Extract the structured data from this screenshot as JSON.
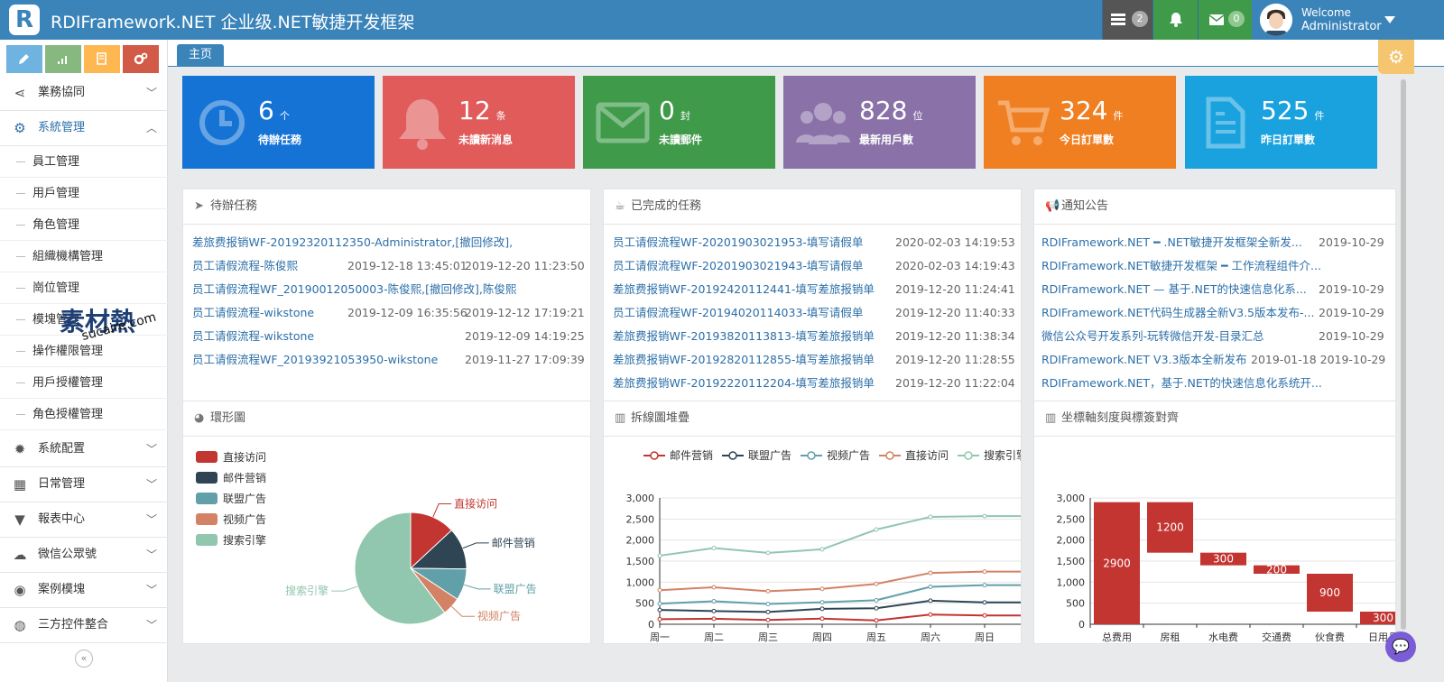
{
  "app": {
    "logo_letter": "R",
    "title": "RDIFramework.NET 企业级.NET敏捷开发框架"
  },
  "topbar": {
    "tasks_badge": "2",
    "mail_badge": "0",
    "welcome": "Welcome",
    "user": "Administrator",
    "colors": {
      "bar": "#3b84ba",
      "tasks_btn": "#555555",
      "bell_btn": "#3f9a4a",
      "mail_btn": "#3f9a4a"
    }
  },
  "sidebar": {
    "tools": [
      "pencil-icon",
      "signal-icon",
      "book-icon",
      "cogs-icon"
    ],
    "tool_colors": [
      "#6fb3e0",
      "#87b87f",
      "#ffb752",
      "#d15b47"
    ],
    "menus": [
      {
        "label": "業務協同",
        "icon": "share-icon"
      },
      {
        "label": "系統管理",
        "icon": "cogs-icon",
        "active": true
      }
    ],
    "submenu": [
      "員工管理",
      "用戶管理",
      "角色管理",
      "組織機構管理",
      "崗位管理",
      "模塊管理",
      "操作權限管理",
      "用戶授權管理",
      "角色授權管理"
    ],
    "menus_after": [
      {
        "label": "系統配置",
        "icon": "gear-icon"
      },
      {
        "label": "日常管理",
        "icon": "calendar-icon"
      },
      {
        "label": "報表中心",
        "icon": "filter-icon"
      },
      {
        "label": "微信公眾號",
        "icon": "wechat-icon"
      },
      {
        "label": "案例模塊",
        "icon": "eye-icon"
      },
      {
        "label": "三方控件整合",
        "icon": "globe-icon"
      }
    ],
    "collapse_glyph": "«"
  },
  "tabs": {
    "home": "主页"
  },
  "watermark": {
    "text": "素材熱",
    "sub": "sucaire.com"
  },
  "tiles": [
    {
      "num": "6",
      "unit": "个",
      "label": "待辦任務",
      "color": "#1573d6",
      "icon": "clock-icon"
    },
    {
      "num": "12",
      "unit": "条",
      "label": "未讀新消息",
      "color": "#e15b5b",
      "icon": "bell-icon"
    },
    {
      "num": "0",
      "unit": "封",
      "label": "未讀郵件",
      "color": "#3f9a4a",
      "icon": "envelope-icon"
    },
    {
      "num": "828",
      "unit": "位",
      "label": "最新用戶數",
      "color": "#8a72a8",
      "icon": "users-icon"
    },
    {
      "num": "324",
      "unit": "件",
      "label": "今日訂單數",
      "color": "#f07f22",
      "icon": "cart-icon"
    },
    {
      "num": "525",
      "unit": "件",
      "label": "昨日訂單數",
      "color": "#1aa2de",
      "icon": "file-icon"
    }
  ],
  "pending": {
    "title": "待辦任務",
    "rows": [
      {
        "text": "差旅费报销WF-20192320112350-Administrator,[撤回修改],",
        "d1": "",
        "d2": ""
      },
      {
        "text": "员工请假流程-陈俊熙",
        "d1": "2019-12-18 13:45:01",
        "d2": "2019-12-20 11:23:50"
      },
      {
        "text": "员工请假流程WF_20190012050003-陈俊熙,[撤回修改],陈俊熙",
        "d1": "",
        "d2": ""
      },
      {
        "text": "员工请假流程-wikstone",
        "d1": "2019-12-09 16:35:56",
        "d2": "2019-12-12 17:19:21"
      },
      {
        "text": "员工请假流程-wikstone",
        "d1": "",
        "d2": "2019-12-09 14:19:25"
      },
      {
        "text": "员工请假流程WF_20193921053950-wikstone",
        "d1": "",
        "d2": "2019-11-27 17:09:39"
      }
    ]
  },
  "done": {
    "title": "已完成的任務",
    "rows": [
      {
        "text": "员工请假流程WF-20201903021953-填写请假单",
        "d": "2020-02-03 14:19:53"
      },
      {
        "text": "员工请假流程WF-20201903021943-填写请假单",
        "d": "2020-02-03 14:19:43"
      },
      {
        "text": "差旅费报销WF-20192420112441-填写差旅报销单",
        "d": "2019-12-20 11:24:41"
      },
      {
        "text": "员工请假流程WF-20194020114033-填写请假单",
        "d": "2019-12-20 11:40:33"
      },
      {
        "text": "差旅费报销WF-20193820113813-填写差旅报销单",
        "d": "2019-12-20 11:38:34"
      },
      {
        "text": "差旅费报销WF-20192820112855-填写差旅报销单",
        "d": "2019-12-20 11:28:55"
      },
      {
        "text": "差旅费报销WF-20192220112204-填写差旅报销单",
        "d": "2019-12-20 11:22:04"
      }
    ]
  },
  "notice": {
    "title": "通知公告",
    "rows": [
      {
        "text": "RDIFramework.NET ━ .NET敏捷开发框架全新发...",
        "d": "2019-10-29"
      },
      {
        "text": "RDIFramework.NET敏捷开发框架 ━ 工作流程组件介...",
        "d": ""
      },
      {
        "text": "RDIFramework.NET — 基于.NET的快速信息化系...",
        "d": "2019-10-29"
      },
      {
        "text": "RDIFramework.NET代码生成器全新V3.5版本发布-...",
        "d": "2019-10-29"
      },
      {
        "text": "微信公众号开发系列-玩转微信开发-目录汇总",
        "d": "2019-10-29"
      },
      {
        "text": "RDIFramework.NET V3.3版本全新发布",
        "d": "2019-01-18 2019-10-29"
      },
      {
        "text": "RDIFramework.NET，基于.NET的快速信息化系统开...",
        "d": ""
      }
    ]
  },
  "pie_panel": {
    "title": "環形圖"
  },
  "line_panel": {
    "title": "拆線圖堆疊"
  },
  "bar_panel": {
    "title": "坐標軸刻度與標簽對齊"
  },
  "chart_data": [
    {
      "type": "pie",
      "slices": [
        {
          "name": "直接访问",
          "value": 335,
          "color": "#c23531"
        },
        {
          "name": "邮件营销",
          "value": 310,
          "color": "#2f4554"
        },
        {
          "name": "联盟广告",
          "value": 234,
          "color": "#61a0a8"
        },
        {
          "name": "视频广告",
          "value": 135,
          "color": "#d48265"
        },
        {
          "name": "搜索引擎",
          "value": 1548,
          "color": "#91c7ae"
        }
      ],
      "legend_position": "top-left"
    },
    {
      "type": "line",
      "categories": [
        "周一",
        "周二",
        "周三",
        "周四",
        "周五",
        "周六",
        "周日"
      ],
      "ylim": [
        0,
        3000
      ],
      "yticks": [
        "0",
        "500",
        "1,000",
        "1,500",
        "2,000",
        "2,500",
        "3,000"
      ],
      "legend_position": "top",
      "series": [
        {
          "name": "邮件营销",
          "color": "#c23531",
          "values": [
            120,
            132,
            101,
            134,
            90,
            230,
            210
          ]
        },
        {
          "name": "联盟广告",
          "color": "#2f4554",
          "values": [
            340,
            314,
            292,
            368,
            380,
            560,
            520
          ]
        },
        {
          "name": "视频广告",
          "color": "#61a0a8",
          "values": [
            490,
            546,
            483,
            522,
            570,
            890,
            930
          ]
        },
        {
          "name": "直接访问",
          "color": "#d48265",
          "values": [
            810,
            878,
            785,
            842,
            960,
            1220,
            1250
          ]
        },
        {
          "name": "搜索引擎",
          "color": "#91c7ae",
          "values": [
            1630,
            1810,
            1695,
            1780,
            2250,
            2550,
            2570
          ]
        }
      ]
    },
    {
      "type": "bar",
      "categories": [
        "总费用",
        "房租",
        "水电费",
        "交通费",
        "伙食费",
        "日用品"
      ],
      "ylim": [
        0,
        3000
      ],
      "yticks": [
        "0",
        "500",
        "1,000",
        "1,500",
        "2,000",
        "2,500",
        "3,000"
      ],
      "base": [
        0,
        1700,
        1400,
        1200,
        300,
        0
      ],
      "values": [
        2900,
        1200,
        300,
        200,
        900,
        300
      ],
      "labels": [
        "2900",
        "1200",
        "300",
        "200",
        "900",
        "300"
      ],
      "color": "#c23531"
    }
  ]
}
